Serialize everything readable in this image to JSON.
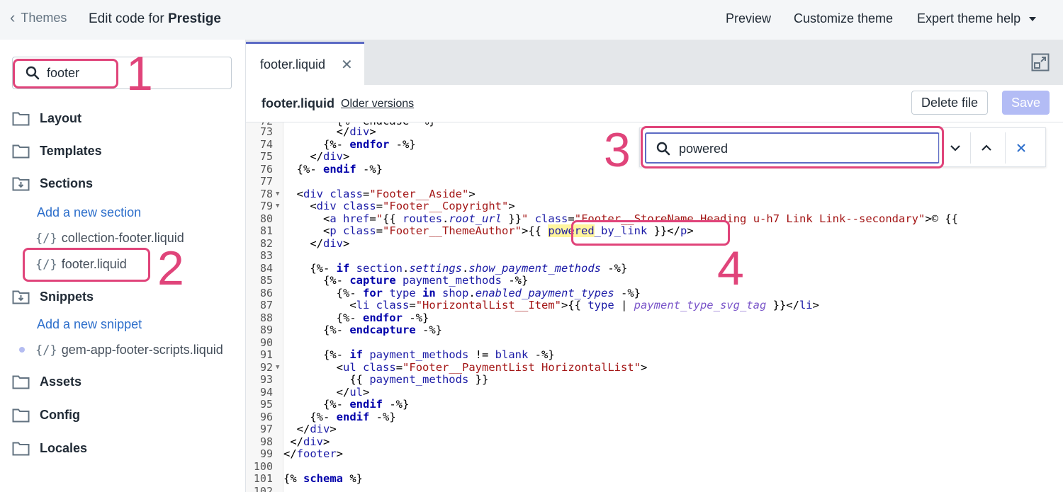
{
  "header": {
    "back_label": "Themes",
    "title_prefix": "Edit code for ",
    "theme_name": "Prestige",
    "preview": "Preview",
    "customize": "Customize theme",
    "help": "Expert theme help"
  },
  "sidebar": {
    "search_value": "footer",
    "folders": {
      "layout": "Layout",
      "templates": "Templates",
      "sections": "Sections",
      "snippets": "Snippets",
      "assets": "Assets",
      "config": "Config",
      "locales": "Locales"
    },
    "add_section": "Add a new section",
    "add_snippet": "Add a new snippet",
    "section_files": [
      "collection-footer.liquid",
      "footer.liquid"
    ],
    "snippet_files": [
      "gem-app-footer-scripts.liquid"
    ],
    "liquid_glyph": "{/}"
  },
  "editor": {
    "tab_label": "footer.liquid",
    "file_name": "footer.liquid",
    "older_versions": "Older versions",
    "delete_file": "Delete file",
    "save": "Save",
    "find_query": "powered"
  },
  "annotations": [
    "1",
    "2",
    "3",
    "4"
  ],
  "colors": {
    "annotation": "#e0447a",
    "accent": "#5c6ac4",
    "link": "#2c6ecb"
  }
}
